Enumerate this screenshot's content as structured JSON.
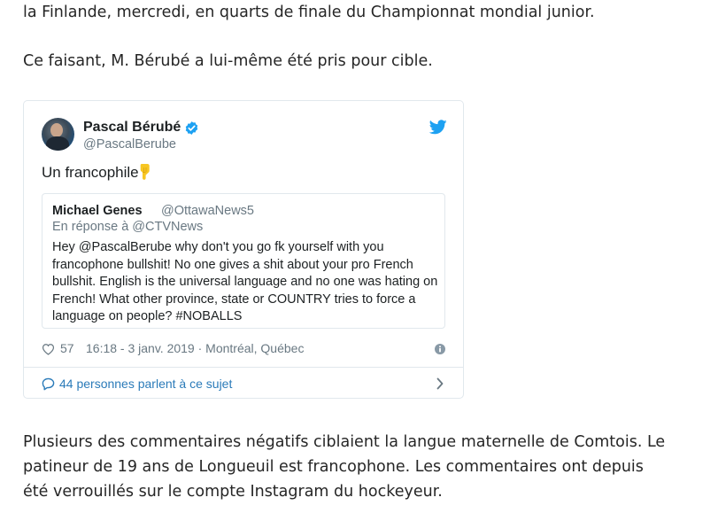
{
  "article": {
    "para_top": "la Finlande, mercredi, en quarts de finale du Championnat mondial junior.",
    "para_mid": "Ce faisant, M. Bérubé a lui-même été pris pour cible.",
    "para_bottom": [
      "Plusieurs des commentaires négatifs ciblaient la langue maternelle de Comtois. Le",
      "patineur de 19 ans de Longueuil est francophone. Les commentaires ont depuis",
      "été verrouillés sur le compte Instagram du hockeyeur."
    ]
  },
  "tweet": {
    "author_name": "Pascal Bérubé",
    "author_handle": "@PascalBerube",
    "verified_icon": "verified-badge-icon",
    "platform_icon": "twitter-bird-icon",
    "text": "Un francophile",
    "emoji": "pointing-down-hand-emoji",
    "quoted": {
      "author_name": "Michael Genes",
      "author_handle": "@OttawaNews5",
      "reply_to": "En réponse à @CTVNews",
      "text_lines": [
        "Hey @PascalBerube why don't you go fk yourself with you",
        "francophone bullshit! No one gives a shit about your pro French",
        "bullshit. English is the universal language and no one was hating on",
        "French! What other province, state or COUNTRY tries to force a",
        "language on people? #NOBALLS"
      ]
    },
    "likes": "57",
    "timestamp": "16:18 - 3 janv. 2019 · Montréal, Québec",
    "conversation_link": "44 personnes parlent à ce sujet",
    "colors": {
      "twitter_blue": "#1da1f2",
      "link_blue": "#2b7bb9",
      "muted_gray": "#697882",
      "border": "#e1e8ed"
    }
  }
}
